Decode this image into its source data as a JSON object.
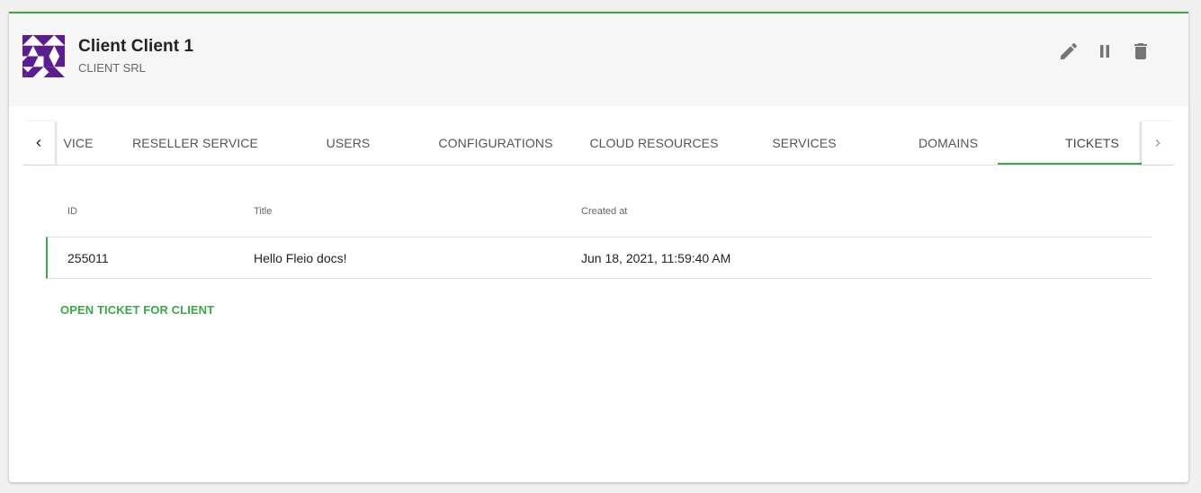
{
  "client": {
    "name": "Client Client 1",
    "company": "CLIENT SRL"
  },
  "header_actions": {
    "edit_icon": "pencil-icon",
    "suspend_icon": "pause-icon",
    "delete_icon": "trash-icon"
  },
  "tabs": [
    {
      "label": "VICE"
    },
    {
      "label": "RESELLER SERVICE"
    },
    {
      "label": "USERS"
    },
    {
      "label": "CONFIGURATIONS"
    },
    {
      "label": "CLOUD RESOURCES"
    },
    {
      "label": "SERVICES"
    },
    {
      "label": "DOMAINS"
    },
    {
      "label": "TICKETS"
    }
  ],
  "active_tab": "TICKETS",
  "tickets": {
    "columns": {
      "id": "ID",
      "title": "Title",
      "created_at": "Created at"
    },
    "rows": [
      {
        "id": "255011",
        "title": "Hello Fleio docs!",
        "created_at": "Jun 18, 2021, 11:59:40 AM"
      }
    ],
    "open_ticket_label": "OPEN TICKET FOR CLIENT"
  },
  "colors": {
    "accent": "#3aa847",
    "avatar": "#5b1d8f"
  }
}
